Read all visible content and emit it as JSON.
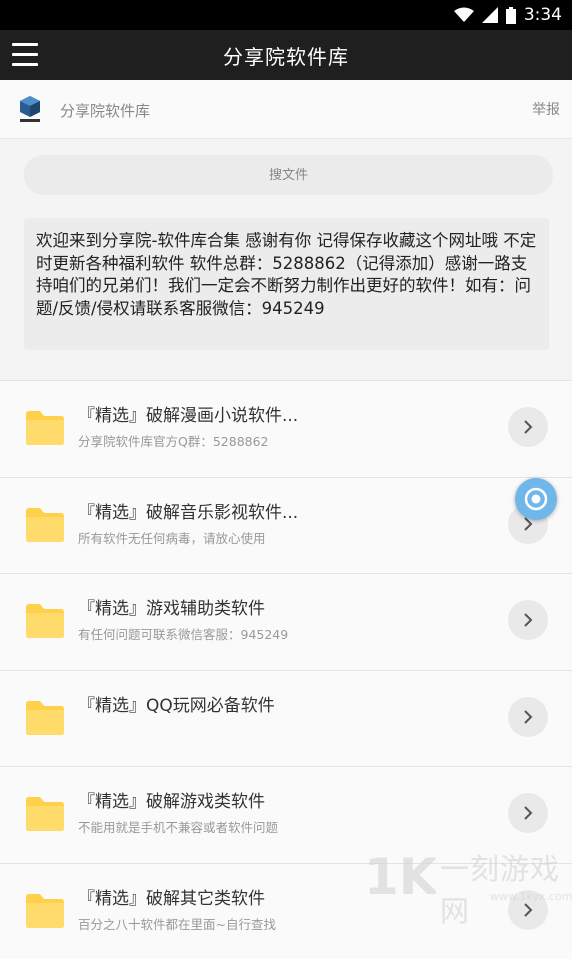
{
  "status_bar": {
    "time": "3:34"
  },
  "app_bar": {
    "title": "分享院软件库"
  },
  "site_header": {
    "name": "分享院软件库",
    "report": "举报"
  },
  "search": {
    "placeholder": "搜文件"
  },
  "notice": {
    "text": "欢迎来到分享院-软件库合集 感谢有你 记得保存收藏这个网址哦 不定时更新各种福利软件 软件总群：5288862（记得添加）感谢一路支持咱们的兄弟们！我们一定会不断努力制作出更好的软件！如有：问题/反馈/侵权请联系客服微信：945249"
  },
  "list": [
    {
      "title": "『精选』破解漫画小说软件...",
      "subtitle": "分享院软件库官方Q群：5288862"
    },
    {
      "title": "『精选』破解音乐影视软件...",
      "subtitle": "所有软件无任何病毒，请放心使用"
    },
    {
      "title": "『精选』游戏辅助类软件",
      "subtitle": "有任何问题可联系微信客服：945249"
    },
    {
      "title": "『精选』QQ玩网必备软件",
      "subtitle": ""
    },
    {
      "title": "『精选』破解游戏类软件",
      "subtitle": "不能用就是手机不兼容或者软件问题"
    },
    {
      "title": "『精选』破解其它类软件",
      "subtitle": "百分之八十软件都在里面~自行查找"
    }
  ],
  "watermark": {
    "text": "一刻游戏网",
    "url": "www.1kyx.com"
  },
  "colors": {
    "app_bar": "#1f1f1f",
    "folder": "#ffd04a",
    "float_button": "#6fb6ea"
  }
}
